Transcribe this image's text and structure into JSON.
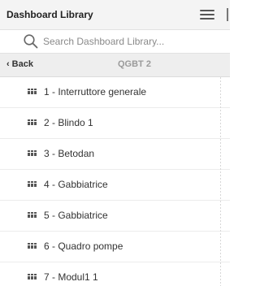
{
  "header": {
    "title": "Dashboard Library",
    "menu_icon": "hamburger-menu-icon"
  },
  "search": {
    "placeholder": "Search Dashboard Library...",
    "value": "",
    "icon": "search-icon"
  },
  "nav": {
    "back_label": "Back",
    "breadcrumb": "QGBT 2"
  },
  "items": [
    {
      "label": "1 - Interruttore generale",
      "icon": "grid-icon"
    },
    {
      "label": "2 - Blindo 1",
      "icon": "grid-icon"
    },
    {
      "label": "3 - Betodan",
      "icon": "grid-icon"
    },
    {
      "label": "4 - Gabbiatrice",
      "icon": "grid-icon"
    },
    {
      "label": "5 - Gabbiatrice",
      "icon": "grid-icon"
    },
    {
      "label": "6 - Quadro pompe",
      "icon": "grid-icon"
    },
    {
      "label": "7 - Modul1 1",
      "icon": "grid-icon"
    }
  ]
}
